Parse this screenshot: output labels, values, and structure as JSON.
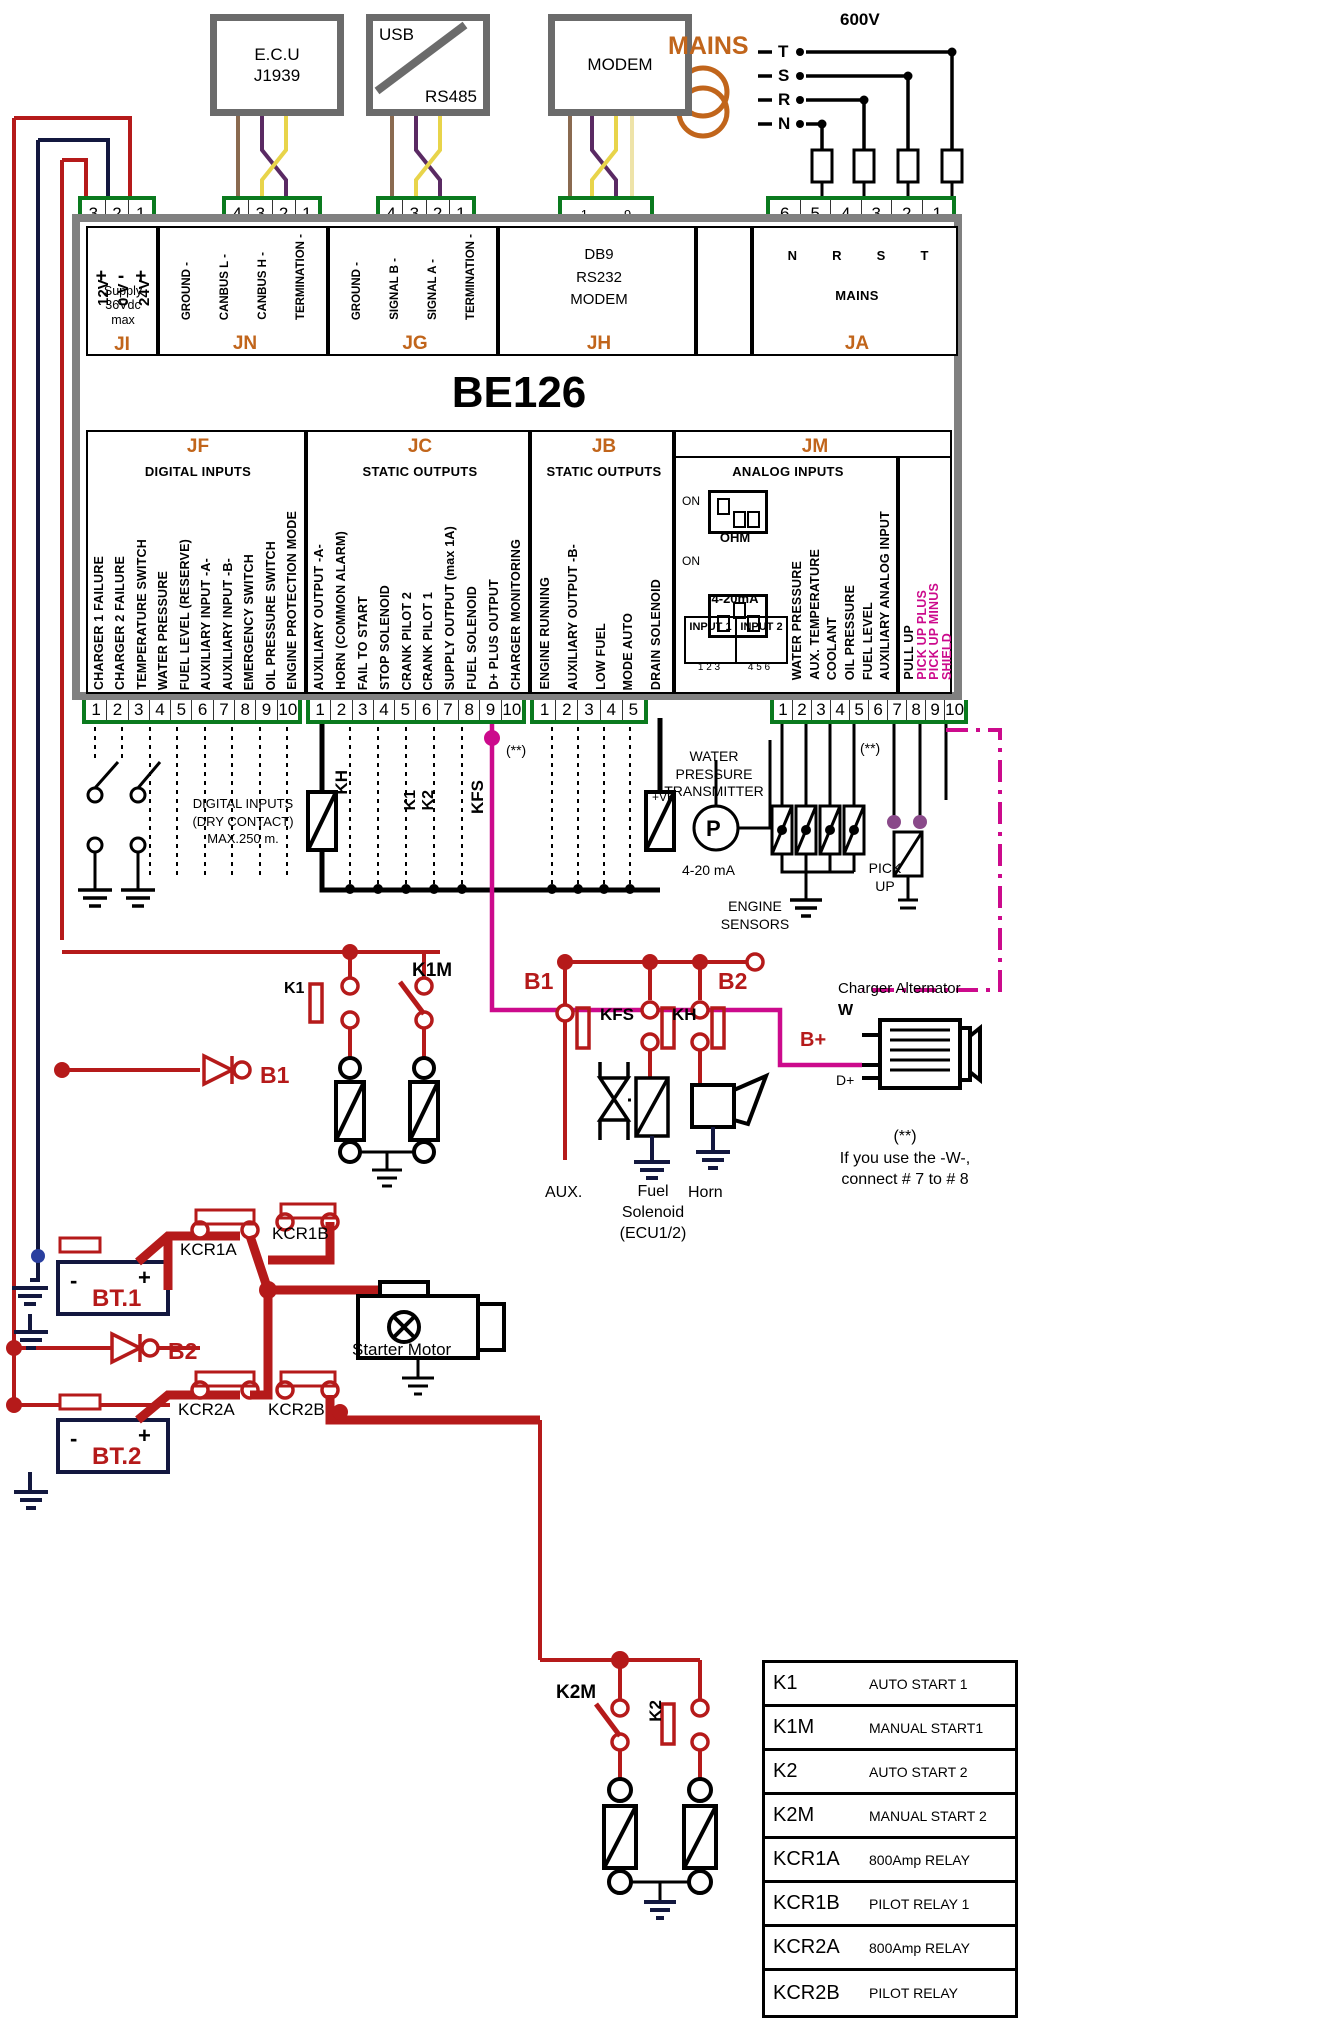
{
  "title": "BE126",
  "devices": [
    {
      "name": "ecu",
      "lines": [
        "E.C.U",
        "J1939"
      ]
    },
    {
      "name": "usb",
      "lines": [
        "USB",
        "RS485"
      ]
    },
    {
      "name": "modem",
      "lines": [
        "MODEM"
      ]
    }
  ],
  "mains": {
    "label": "MAINS",
    "voltage": "600V",
    "phases": [
      "T",
      "S",
      "R",
      "N"
    ]
  },
  "connectors": {
    "ji": {
      "pins": [
        "3",
        "2",
        "1"
      ]
    },
    "jn": {
      "pins": [
        "4",
        "3",
        "2",
        "1"
      ]
    },
    "jg": {
      "pins": [
        "4",
        "3",
        "2",
        "1"
      ]
    },
    "jh": {
      "pins": [
        "1..........9"
      ]
    },
    "ja": {
      "pins": [
        "6",
        "5",
        "4",
        "3",
        "2",
        "1"
      ]
    },
    "jf": {
      "pins": [
        "1",
        "2",
        "3",
        "4",
        "5",
        "6",
        "7",
        "8",
        "9",
        "10"
      ]
    },
    "jc": {
      "pins": [
        "1",
        "2",
        "3",
        "4",
        "5",
        "6",
        "7",
        "8",
        "9",
        "10"
      ]
    },
    "jb": {
      "pins": [
        "1",
        "2",
        "3",
        "4",
        "5"
      ]
    },
    "jm": {
      "pins": [
        "1",
        "2",
        "3",
        "4",
        "5",
        "6",
        "7",
        "8",
        "9",
        "10"
      ]
    }
  },
  "blocks": {
    "ji": {
      "tag": "JI",
      "volt_labels": [
        "12V",
        "0 V",
        "24V"
      ],
      "sign_labels": [
        "+",
        "-",
        "+"
      ],
      "supply": "Supply",
      "supply2": "36Vdc",
      "supply3": "max"
    },
    "jn": {
      "tag": "JN",
      "pins": [
        "GROUND  -",
        "CANBUS L  -",
        "CANBUS H  -",
        "TERMINATION  -"
      ]
    },
    "jg": {
      "tag": "JG",
      "pins": [
        "GROUND  -",
        "SIGNAL B  -",
        "SIGNAL A  -",
        "TERMINATION  -"
      ]
    },
    "jh": {
      "tag": "JH",
      "lines": [
        "DB9",
        "RS232",
        "MODEM"
      ]
    },
    "ja": {
      "tag": "JA",
      "title": "MAINS",
      "pins": [
        "N",
        "R",
        "S",
        "T"
      ]
    },
    "jf": {
      "tag": "JF",
      "title": "DIGITAL INPUTS",
      "pins": [
        "CHARGER 1 FAILURE",
        "CHARGER 2 FAILURE",
        "TEMPERATURE SWITCH",
        "WATER PRESSURE",
        "FUEL LEVEL (RESERVE)",
        "AUXILIARY INPUT -A-",
        "AUXILIARY INPUT -B-",
        "EMERGENCY SWITCH",
        "OIL PRESSURE SWITCH",
        "ENGINE PROTECTION MODE"
      ]
    },
    "jc": {
      "tag": "JC",
      "title": "STATIC OUTPUTS",
      "pins": [
        "AUXILIARY OUTPUT -A-",
        "HORN (COMMON ALARM)",
        "FAIL TO START",
        "STOP SOLENOID",
        "CRANK PILOT 2",
        "CRANK PILOT 1",
        "SUPPLY OUTPUT (max 1A)",
        "FUEL SOLENOID",
        "D+ PLUS OUTPUT",
        "CHARGER MONITORING"
      ]
    },
    "jb": {
      "tag": "JB",
      "title": "STATIC OUTPUTS",
      "pins": [
        "ENGINE RUNNING",
        "AUXILIARY OUTPUT -B-",
        "LOW FUEL",
        "MODE AUTO",
        "DRAIN SOLENOID"
      ]
    },
    "jm": {
      "tag": "JM",
      "title": "ANALOG INPUTS",
      "ohm": "OHM",
      "ma": "4-20mA",
      "on": "ON",
      "input1": "INPUT 1",
      "input2": "INPUT 2",
      "dip1": "1  2  3",
      "dip2": "4  5  6",
      "pins": [
        "WATER PRESSURE",
        "AUX. TEMPERATURE",
        "COOLANT",
        "OIL PRESSURE",
        "FUEL LEVEL",
        "AUXILIARY ANALOG INPUT",
        "PULL UP",
        "PICK UP PLUS",
        "PICK UP MINUS",
        "SHIELD"
      ]
    }
  },
  "annotations": {
    "digital_inputs_note": [
      "DIGITAL INPUTS",
      "(DRY CONTACT)",
      "MAX.250 m."
    ],
    "kh": "KH",
    "k1": "K1",
    "k2": "K2",
    "kfs": "KFS",
    "asterisk1": "(**)",
    "asterisk2": "(**)",
    "water_pressure_transmitter": [
      "WATER",
      "PRESSURE",
      "TRANSMITTER"
    ],
    "wpt_range": "4-20 mA",
    "wpt_p": "P",
    "vb": "+VB",
    "engine_sensors": [
      "ENGINE",
      "SENSORS"
    ],
    "pick_up": [
      "PICK",
      "UP"
    ],
    "charger_alternator": "Charger Alternator",
    "alt_w": "W",
    "alt_bplus": "B+",
    "alt_dplus": "D+",
    "note_star": [
      "(**)",
      "If you use the -W-,",
      "connect # 7 to # 8"
    ],
    "b1": "B1",
    "b2": "B2",
    "k1_label": "K1",
    "k1m_label": "K1M",
    "k2_label": "K2",
    "k2m_label": "K2M",
    "aux": "AUX.",
    "fuel_solenoid": [
      "Fuel",
      "Solenoid",
      "(ECU1/2)"
    ],
    "horn": "Horn",
    "b1_diode": "B1",
    "b2_diode": "B2",
    "battery1": "BT.1",
    "battery2": "BT.2",
    "bat_minus": "-",
    "bat_plus": "+",
    "kcr1a": "KCR1A",
    "kcr1b": "KCR1B",
    "kcr2a": "KCR2A",
    "kcr2b": "KCR2B",
    "starter_motor": "Starter Motor"
  },
  "legend": {
    "rows": [
      {
        "key": "K1",
        "desc": "AUTO START 1"
      },
      {
        "key": "K1M",
        "desc": "MANUAL START1"
      },
      {
        "key": "K2",
        "desc": "AUTO START 2"
      },
      {
        "key": "K2M",
        "desc": "MANUAL START 2"
      },
      {
        "key": "KCR1A",
        "desc": "800Amp RELAY"
      },
      {
        "key": "KCR1B",
        "desc": "PILOT RELAY 1"
      },
      {
        "key": "KCR2A",
        "desc": "800Amp RELAY"
      },
      {
        "key": "KCR2B",
        "desc": "PILOT RELAY"
      }
    ]
  },
  "colors": {
    "green_connector": "#0a7a1e",
    "grey_frame": "#808080",
    "orange_tag": "#c1651b",
    "red_wire": "#b51a1a",
    "navy_wire": "#13183f",
    "magenta_wire": "#cc0a8c",
    "yellow_wire": "#e8d44a",
    "purple_wire": "#5a2a63",
    "brown_wire": "#8a6a50"
  }
}
